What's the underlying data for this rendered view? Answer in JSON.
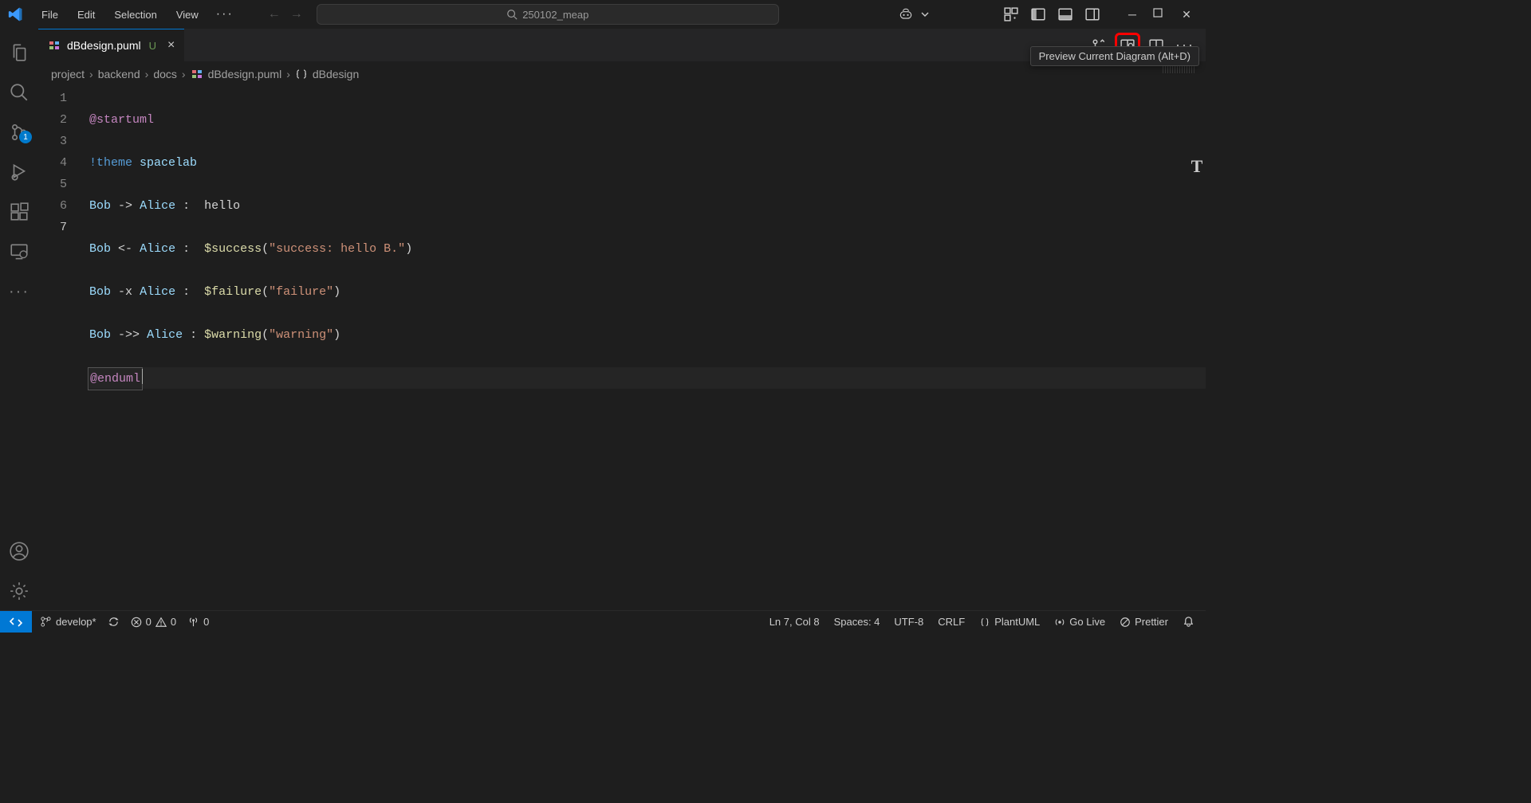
{
  "menu": {
    "file": "File",
    "edit": "Edit",
    "selection": "Selection",
    "view": "View"
  },
  "search": {
    "text": "250102_meap"
  },
  "tab": {
    "filename": "dBdesign.puml",
    "modified": "U"
  },
  "breadcrumb": {
    "p0": "project",
    "p1": "backend",
    "p2": "docs",
    "p3": "dBdesign.puml",
    "p4": "dBdesign"
  },
  "tooltip": {
    "text": "Preview Current Diagram (Alt+D)"
  },
  "lines": {
    "n1": "1",
    "n2": "2",
    "n3": "3",
    "n4": "4",
    "n5": "5",
    "n6": "6",
    "n7": "7"
  },
  "code": {
    "l1_dir": "@startuml",
    "l2_kwd": "!theme",
    "l2_val": "spacelab",
    "l3_a": "Bob",
    "l3_op": "->",
    "l3_b": "Alice",
    "l3_msg": "hello",
    "l4_a": "Bob",
    "l4_op": "<-",
    "l4_b": "Alice",
    "l4_fn": "$success",
    "l4_str": "\"success: hello B.\"",
    "l5_a": "Bob",
    "l5_op": "-x",
    "l5_b": "Alice",
    "l5_fn": "$failure",
    "l5_str": "\"failure\"",
    "l6_a": "Bob",
    "l6_op": "->>",
    "l6_b": "Alice",
    "l6_fn": "$warning",
    "l6_str": "\"warning\"",
    "l7_dir": "@enduml"
  },
  "scm_badge": "1",
  "status": {
    "branch": "develop*",
    "errors": "0",
    "warnings": "0",
    "ports": "0",
    "lncol": "Ln 7, Col 8",
    "spaces": "Spaces: 4",
    "encoding": "UTF-8",
    "eol": "CRLF",
    "lang": "PlantUML",
    "golive": "Go Live",
    "prettier": "Prettier"
  }
}
